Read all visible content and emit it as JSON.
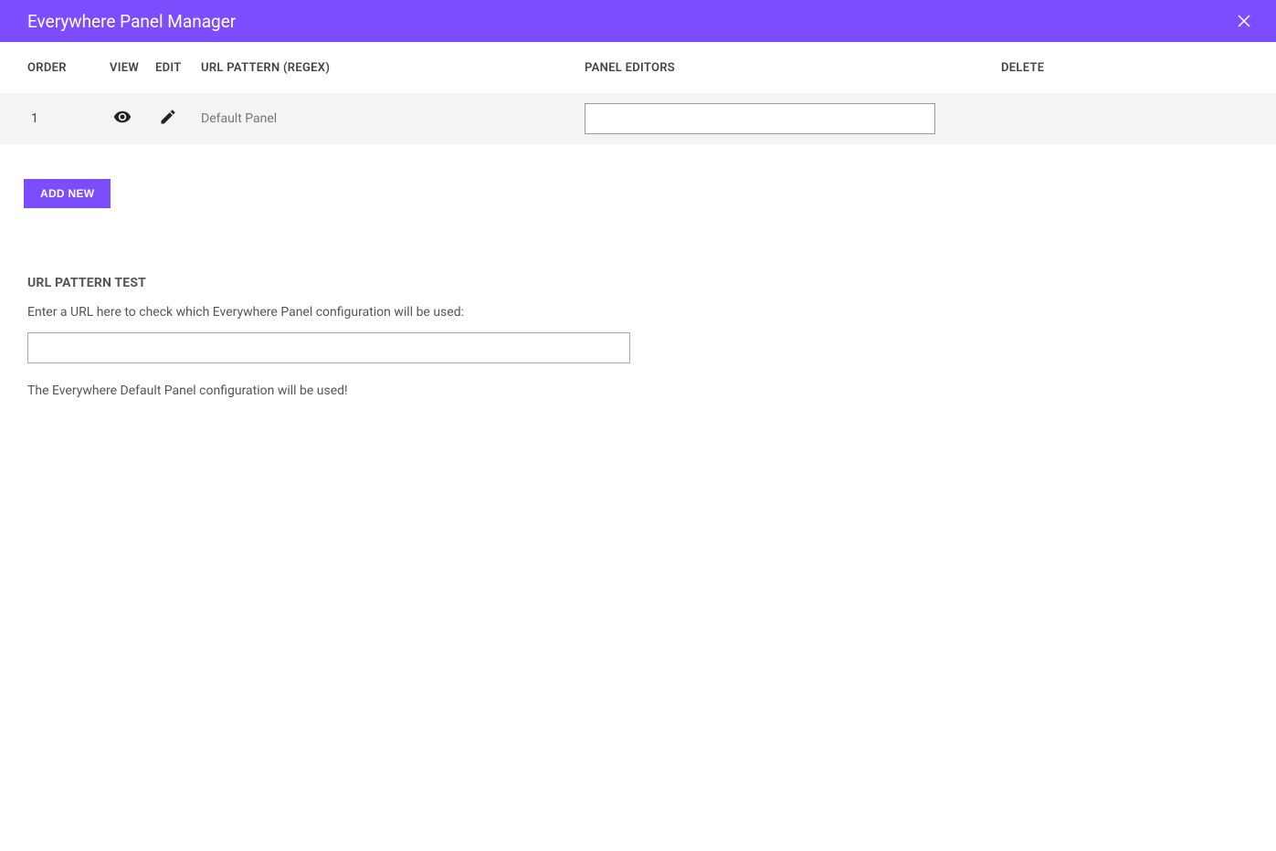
{
  "header": {
    "title": "Everywhere Panel Manager"
  },
  "table": {
    "headers": {
      "order": "ORDER",
      "view": "VIEW",
      "edit": "EDIT",
      "url_pattern": "URL PATTERN (REGEX)",
      "panel_editors": "PANEL EDITORS",
      "delete": "DELETE"
    },
    "rows": [
      {
        "order": "1",
        "url_pattern": "Default Panel",
        "panel_editors_value": ""
      }
    ]
  },
  "add_new": {
    "label": "ADD NEW"
  },
  "url_test": {
    "heading": "URL PATTERN TEST",
    "description": "Enter a URL here to check which Everywhere Panel configuration will be used:",
    "input_value": "",
    "result": "The Everywhere Default Panel configuration will be used!"
  }
}
